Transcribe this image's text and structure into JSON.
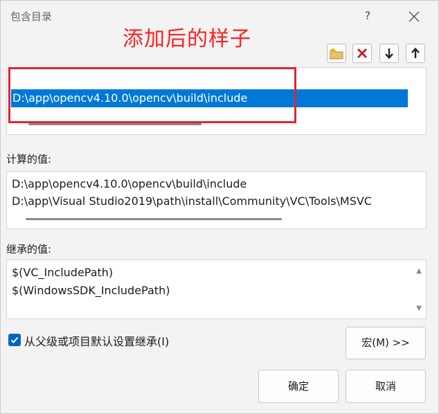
{
  "window": {
    "title": "包含目录",
    "help_label": "?"
  },
  "annotation": "添加后的样子",
  "toolbar": {
    "icons": [
      "new-folder-icon",
      "delete-icon",
      "move-down-icon",
      "move-up-icon"
    ]
  },
  "directories": {
    "items": [
      "",
      "D:\\app\\opencv4.10.0\\opencv\\build\\include"
    ],
    "selected_index": 1
  },
  "evaluated": {
    "label": "计算的值:",
    "lines": [
      "D:\\app\\opencv4.10.0\\opencv\\build\\include",
      "D:\\app\\Visual Studio2019\\path\\install\\Community\\VC\\Tools\\MSVC"
    ]
  },
  "inherited": {
    "label": "继承的值:",
    "lines": [
      "$(VC_IncludePath)",
      "$(WindowsSDK_IncludePath)"
    ]
  },
  "inherit_checkbox": {
    "label": "从父级或项目默认设置继承(I)",
    "checked": true
  },
  "macros_button": "宏(M) >>",
  "ok_button": "确定",
  "cancel_button": "取消",
  "colors": {
    "selection": "#0078d7",
    "annotation": "#ff2020",
    "frame": "#e0242f",
    "checkbox": "#0067c0"
  }
}
